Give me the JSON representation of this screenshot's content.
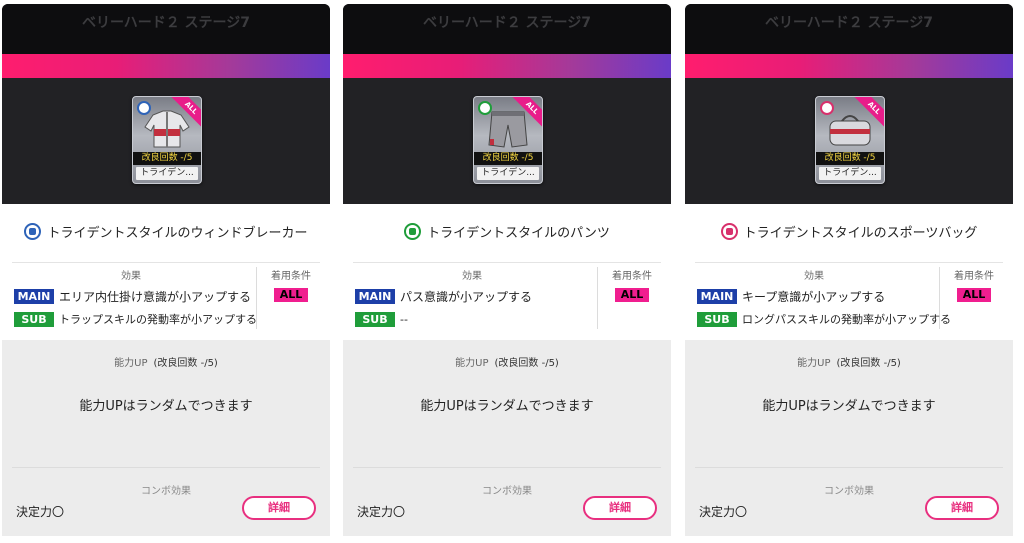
{
  "cards": [
    {
      "stage_title": "ベリーハード２ ステージ7",
      "thumb": {
        "corner": "ALL",
        "count": "改良回数 -/5",
        "name": "トライデン..."
      },
      "item_name": "トライデントスタイルのウィンドブレーカー",
      "icon": "jacket-icon",
      "effect_label": "効果",
      "condition_label": "着用条件",
      "main_tag": "MAIN",
      "main_text": "エリア内仕掛け意識が小アップする",
      "sub_tag": "SUB",
      "sub_text": "トラップスキルの発動率が小アップする",
      "condition": "ALL",
      "ability_label": "能力UP",
      "ability_count": "(改良回数 -/5)",
      "random_text": "能力UPはランダムでつきます",
      "combo_label": "コンボ効果",
      "combo_value": "決定力〇",
      "detail_button": "詳細"
    },
    {
      "stage_title": "ベリーハード２ ステージ7",
      "thumb": {
        "corner": "ALL",
        "count": "改良回数 -/5",
        "name": "トライデン..."
      },
      "item_name": "トライデントスタイルのパンツ",
      "icon": "pants-icon",
      "effect_label": "効果",
      "condition_label": "着用条件",
      "main_tag": "MAIN",
      "main_text": "パス意識が小アップする",
      "sub_tag": "SUB",
      "sub_text": "--",
      "condition": "ALL",
      "ability_label": "能力UP",
      "ability_count": "(改良回数 -/5)",
      "random_text": "能力UPはランダムでつきます",
      "combo_label": "コンボ効果",
      "combo_value": "決定力〇",
      "detail_button": "詳細"
    },
    {
      "stage_title": "ベリーハード２ ステージ7",
      "thumb": {
        "corner": "ALL",
        "count": "改良回数 -/5",
        "name": "トライデン..."
      },
      "item_name": "トライデントスタイルのスポーツバッグ",
      "icon": "bag-icon",
      "effect_label": "効果",
      "condition_label": "着用条件",
      "main_tag": "MAIN",
      "main_text": "キープ意識が小アップする",
      "sub_tag": "SUB",
      "sub_text": "ロングパススキルの発動率が小アップする",
      "condition": "ALL",
      "ability_label": "能力UP",
      "ability_count": "(改良回数 -/5)",
      "random_text": "能力UPはランダムでつきます",
      "combo_label": "コンボ効果",
      "combo_value": "決定力〇",
      "detail_button": "詳細"
    }
  ],
  "colors": {
    "ribbon_start": "#ff1d6e",
    "ribbon_end": "#6a3bc8",
    "main_tag": "#1d3fa8",
    "sub_tag": "#1f9d3a",
    "all_tag": "#f01e8f",
    "detail_button": "#e82f7f"
  }
}
